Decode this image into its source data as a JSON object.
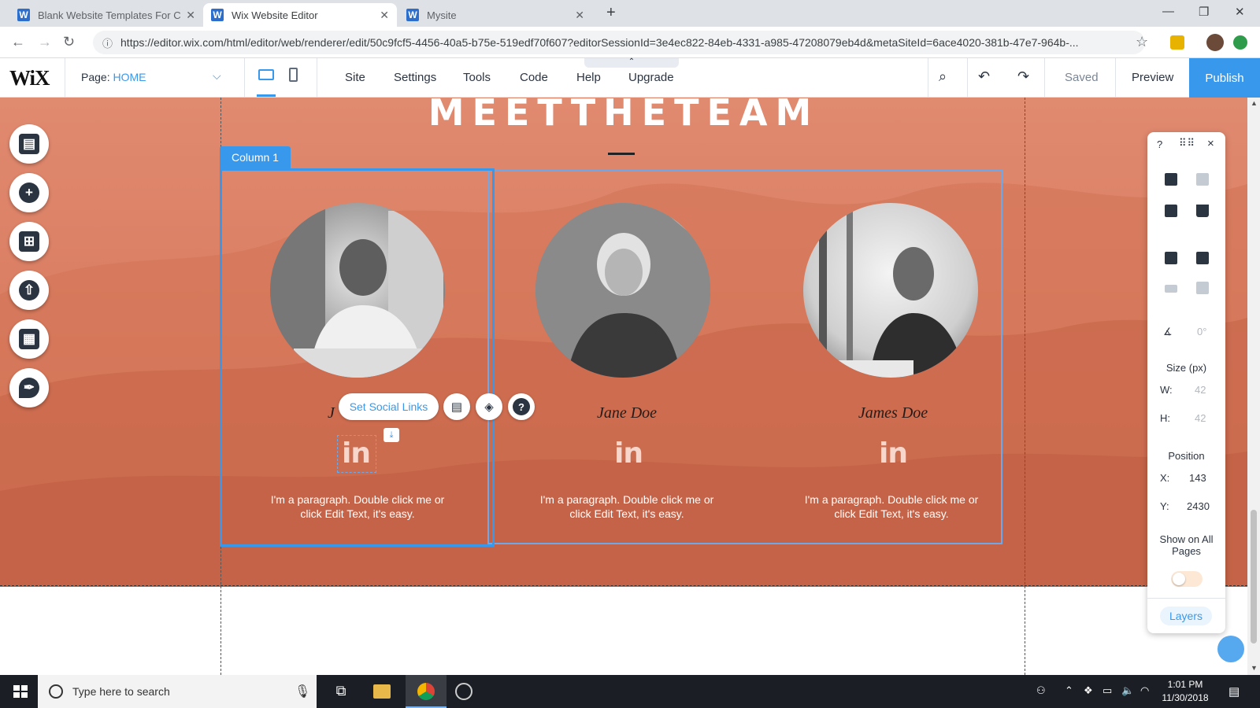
{
  "browser": {
    "tabs": [
      {
        "title": "Blank Website Templates For Cre",
        "active": false
      },
      {
        "title": "Wix Website Editor",
        "active": true
      },
      {
        "title": "Mysite",
        "active": false
      }
    ],
    "new_tab": "+",
    "url": "https://editor.wix.com/html/editor/web/renderer/edit/50c9fcf5-4456-40a5-b75e-519edf70f607?editorSessionId=3e4ec822-84eb-4331-a985-47208079eb4d&metaSiteId=6ace4020-381b-47e7-964b-..."
  },
  "editor": {
    "logo": "WiX",
    "page_label": "Page:",
    "page_name": "HOME",
    "menu": [
      "Site",
      "Settings",
      "Tools",
      "Code",
      "Help",
      "Upgrade"
    ],
    "status": "Saved",
    "preview": "Preview",
    "publish": "Publish"
  },
  "canvas": {
    "title": "MEETTHETEAM",
    "column_badge": "Column 1",
    "members": [
      {
        "name": "J",
        "social": "in",
        "paragraph": "I'm a paragraph. Double click me or click Edit Text, it's easy."
      },
      {
        "name": "Jane Doe",
        "social": "in",
        "paragraph": "I'm a paragraph. Double click me or click Edit Text, it's easy."
      },
      {
        "name": "James Doe",
        "social": "in",
        "paragraph": "I'm a paragraph. Double click me or click Edit Text, it's easy."
      }
    ],
    "social_links_button": "Set Social Links",
    "help_button": "?"
  },
  "right_panel": {
    "help": "?",
    "close": "×",
    "rotation": "0°",
    "size_label": "Size (px)",
    "width_key": "W:",
    "width_value": "42",
    "height_key": "H:",
    "height_value": "42",
    "position_label": "Position",
    "x_key": "X:",
    "x_value": "143",
    "y_key": "Y:",
    "y_value": "2430",
    "show_on_all_pages": "Show on All Pages",
    "layers": "Layers"
  },
  "taskbar": {
    "search_placeholder": "Type here to search",
    "time": "1:01 PM",
    "date": "11/30/2018"
  },
  "colors": {
    "accent": "#3899ec",
    "background": "#d97c60"
  }
}
